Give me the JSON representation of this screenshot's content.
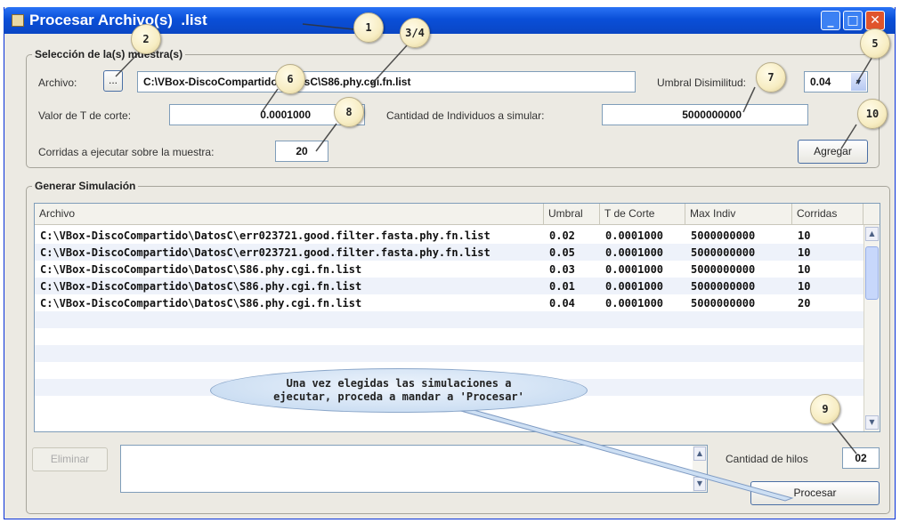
{
  "window": {
    "title": "Procesar Archivo(s)  .list",
    "minimize_label": "_",
    "maximize_label": "□",
    "close_label": "✕"
  },
  "seleccion": {
    "group_title": "Selección de la(s) muestra(s)",
    "archivo_label": "Archivo:",
    "browse_label": "...",
    "archivo_value": "C:\\VBox-DiscoCompartido\\DatosC\\S86.phy.cgi.fn.list",
    "umbral_label": "Umbral Disimilitud:",
    "umbral_value": "0.04",
    "t_corte_label": "Valor de T de corte:",
    "t_corte_value": "0.0001000",
    "individuos_label": "Cantidad de Individuos a simular:",
    "individuos_value": "5000000000",
    "corridas_label": "Corridas a ejecutar sobre la muestra:",
    "corridas_value": "20",
    "agregar_label": "Agregar"
  },
  "simulacion": {
    "group_title": "Generar Simulación",
    "columns": [
      "Archivo",
      "Umbral",
      "T de Corte",
      "Max Indiv",
      "Corridas"
    ],
    "rows": [
      [
        "C:\\VBox-DiscoCompartido\\DatosC\\err023721.good.filter.fasta.phy.fn.list",
        "0.02",
        "0.0001000",
        "5000000000",
        "10"
      ],
      [
        "C:\\VBox-DiscoCompartido\\DatosC\\err023721.good.filter.fasta.phy.fn.list",
        "0.05",
        "0.0001000",
        "5000000000",
        "10"
      ],
      [
        "C:\\VBox-DiscoCompartido\\DatosC\\S86.phy.cgi.fn.list",
        "0.03",
        "0.0001000",
        "5000000000",
        "10"
      ],
      [
        "C:\\VBox-DiscoCompartido\\DatosC\\S86.phy.cgi.fn.list",
        "0.01",
        "0.0001000",
        "5000000000",
        "10"
      ],
      [
        "C:\\VBox-DiscoCompartido\\DatosC\\S86.phy.cgi.fn.list",
        "0.04",
        "0.0001000",
        "5000000000",
        "20"
      ]
    ],
    "eliminar_label": "Eliminar",
    "hilos_label": "Cantidad de hilos",
    "hilos_value": "02",
    "procesar_label": "Procesar"
  },
  "annotations": {
    "badges": [
      "1",
      "2",
      "3/4",
      "5",
      "6",
      "7",
      "8",
      "9",
      "10"
    ],
    "callout_line1": "Una vez elegidas las simulaciones a",
    "callout_line2": "ejecutar, proceda a mandar a 'Procesar'"
  },
  "colors": {
    "title_bar": "#0a4fd8",
    "window_bg": "#eceae3",
    "callout_fill": "#cddff3",
    "badge_fill": "#f7edc3"
  }
}
